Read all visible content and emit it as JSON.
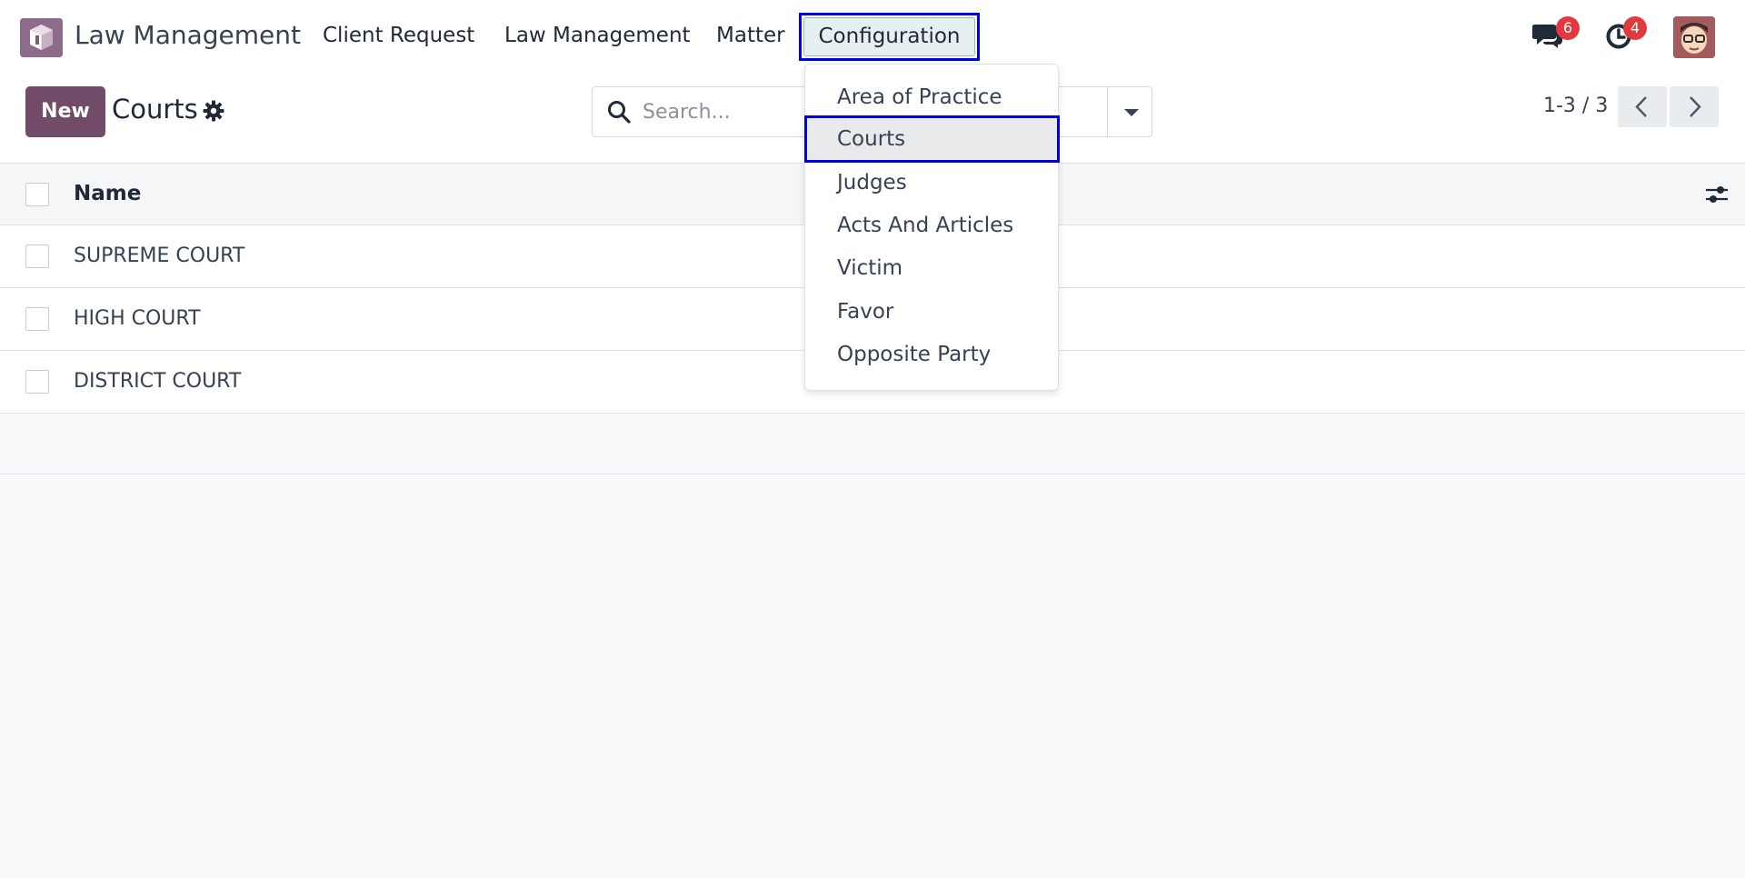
{
  "navbar": {
    "app_name": "Law Management",
    "menu": [
      {
        "label": "Client Request"
      },
      {
        "label": "Law Management"
      },
      {
        "label": "Matter"
      },
      {
        "label": "Configuration"
      }
    ],
    "messages_count": "6",
    "activities_count": "4"
  },
  "control_panel": {
    "new_label": "New",
    "title": "Courts",
    "search_placeholder": "Search...",
    "pager": "1-3 / 3"
  },
  "table": {
    "columns": [
      {
        "label": "Name"
      }
    ],
    "rows": [
      {
        "name": "SUPREME COURT"
      },
      {
        "name": "HIGH COURT"
      },
      {
        "name": "DISTRICT COURT"
      }
    ]
  },
  "dropdown": {
    "items": [
      {
        "label": "Area of Practice"
      },
      {
        "label": "Courts"
      },
      {
        "label": "Judges"
      },
      {
        "label": "Acts And Articles"
      },
      {
        "label": "Victim"
      },
      {
        "label": "Favor"
      },
      {
        "label": "Opposite Party"
      }
    ],
    "active": "Courts"
  },
  "colors": {
    "brand": "#714b67",
    "highlight_outline": "#0000e0",
    "badge": "#e0393e"
  }
}
